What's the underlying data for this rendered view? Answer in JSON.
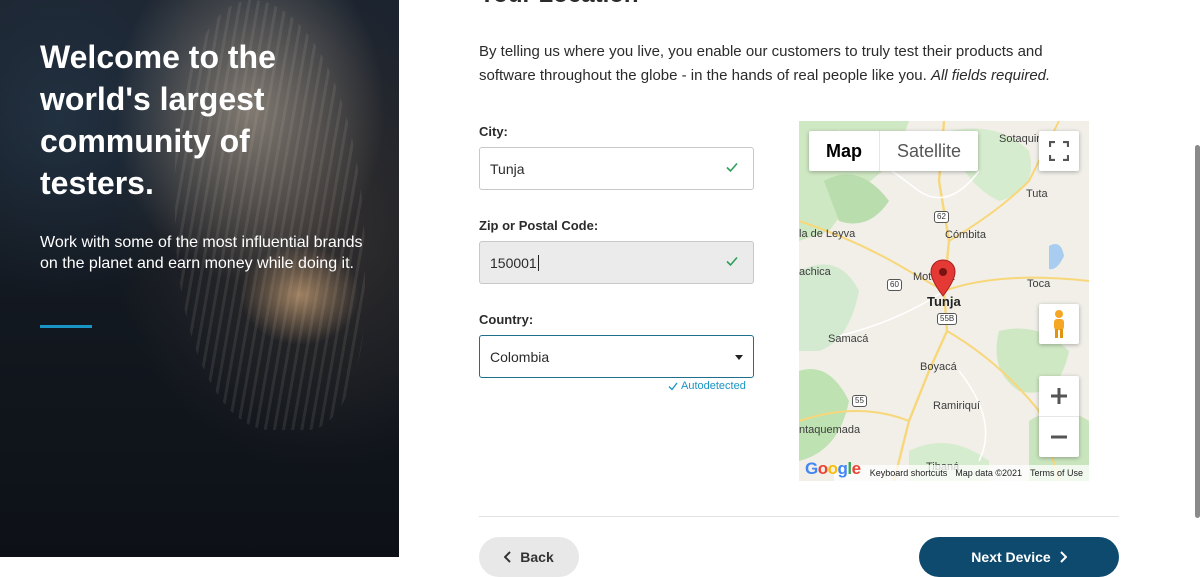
{
  "hero": {
    "title": "Welcome to the world's largest community of testers.",
    "subtitle": "Work with some of the most influential brands on the planet and earn money while doing it.",
    "accent_color": "#1a94c4"
  },
  "form": {
    "heading": "Your Location",
    "intro_text": "By telling us where you live, you enable our customers to truly test their products and software throughout the globe - in the hands of real people like you.",
    "intro_note": "All fields required.",
    "city": {
      "label": "City:",
      "value": "Tunja",
      "status_icon": "check-icon"
    },
    "zip": {
      "label": "Zip or Postal Code:",
      "value": "150001",
      "status_icon": "check-icon"
    },
    "country": {
      "label": "Country:",
      "value": "Colombia",
      "hint": "Autodetected"
    }
  },
  "map": {
    "tabs": [
      "Map",
      "Satellite"
    ],
    "active_tab": "Map",
    "marker_label": "Tunja",
    "places": [
      "Sotaquirá",
      "Tuta",
      "la de Leyva",
      "Cómbita",
      "achica",
      "Motavita",
      "Tunja",
      "Toca",
      "Samacá",
      "Boyacá",
      "Ramiriquí",
      "ntaquemada",
      "Tibaná"
    ],
    "route_shields": [
      "62",
      "60",
      "55B",
      "55"
    ],
    "footer": {
      "shortcuts": "Keyboard shortcuts",
      "data": "Map data ©2021",
      "terms": "Terms of Use"
    },
    "logo": "Google"
  },
  "nav": {
    "back_label": "Back",
    "next_label": "Next Device"
  }
}
